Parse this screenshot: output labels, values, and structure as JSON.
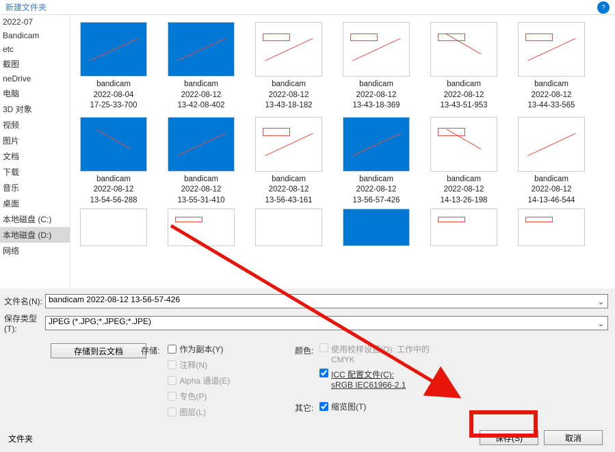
{
  "topbar": {
    "folder_label": "新建文件夹"
  },
  "sidebar": {
    "items": [
      {
        "label": "2022-07"
      },
      {
        "label": "Bandicam"
      },
      {
        "label": "etc"
      },
      {
        "label": "截图"
      },
      {
        "label": "neDrive"
      },
      {
        "label": "电脑"
      },
      {
        "label": "3D 对象"
      },
      {
        "label": "视频"
      },
      {
        "label": "图片"
      },
      {
        "label": "文档"
      },
      {
        "label": "下载"
      },
      {
        "label": "音乐"
      },
      {
        "label": "桌面"
      },
      {
        "label": "本地磁盘 (C:)"
      },
      {
        "label": "本地磁盘 (D:)"
      },
      {
        "label": "网络"
      }
    ],
    "selected_index": 14
  },
  "thumbs": {
    "row1": [
      {
        "l1": "bandicam",
        "l2": "2022-08-04",
        "l3": "17-25-33-700",
        "style": "blue thumb-line1"
      },
      {
        "l1": "bandicam",
        "l2": "2022-08-12",
        "l3": "13-42-08-402",
        "style": "blue thumb-line1"
      },
      {
        "l1": "bandicam",
        "l2": "2022-08-12",
        "l3": "13-43-18-182",
        "style": "white thumb-rect thumb-line1"
      },
      {
        "l1": "bandicam",
        "l2": "2022-08-12",
        "l3": "13-43-18-369",
        "style": "white thumb-rect thumb-line1"
      },
      {
        "l1": "bandicam",
        "l2": "2022-08-12",
        "l3": "13-43-51-953",
        "style": "white thumb-rect thumb-line2"
      },
      {
        "l1": "bandicam",
        "l2": "2022-08-12",
        "l3": "13-44-33-565",
        "style": "white thumb-rect thumb-line1"
      }
    ],
    "row2": [
      {
        "l1": "bandicam",
        "l2": "2022-08-12",
        "l3": "13-54-56-288",
        "style": "blue thumb-line2"
      },
      {
        "l1": "bandicam",
        "l2": "2022-08-12",
        "l3": "13-55-31-410",
        "style": "blue thumb-line1"
      },
      {
        "l1": "bandicam",
        "l2": "2022-08-12",
        "l3": "13-56-43-161",
        "style": "white thumb-rect thumb-line1"
      },
      {
        "l1": "bandicam",
        "l2": "2022-08-12",
        "l3": "13-56-57-426",
        "style": "blue thumb-line1"
      },
      {
        "l1": "bandicam",
        "l2": "2022-08-12",
        "l3": "14-13-26-198",
        "style": "white thumb-rect thumb-line2"
      },
      {
        "l1": "bandicam",
        "l2": "2022-08-12",
        "l3": "14-13-46-544",
        "style": "white thumb-line1"
      }
    ],
    "row3": [
      {
        "style": "white"
      },
      {
        "style": "white thumb-rect"
      },
      {
        "style": "white"
      },
      {
        "style": "blue"
      },
      {
        "style": "white thumb-rect"
      },
      {
        "style": "white thumb-rect"
      }
    ]
  },
  "form": {
    "filename_label": "文件名(N):",
    "filename_value": "bandicam 2022-08-12 13-56-57-426",
    "filetype_label": "保存类型(T):",
    "filetype_value": "JPEG (*.JPG;*.JPEG;*.JPE)",
    "cloud_btn": "存储到云文档"
  },
  "opts": {
    "store_label": "存储:",
    "as_copy": "作为副本(Y)",
    "annot": "注释(N)",
    "alpha": "Alpha 通道(E)",
    "spot": "专色(P)",
    "layers": "图层(L)",
    "color_label": "颜色:",
    "use_proof": "使用校样设置(O): 工作中的 CMYK",
    "icc_line1": "ICC 配置文件(C):",
    "icc_line2": "sRGB IEC61966-2.1",
    "other_label": "其它:",
    "thumb": "缩览图(T)"
  },
  "bottom": {
    "folder_label": "文件夹",
    "save_btn": "保存(S)",
    "cancel_btn": "取消"
  }
}
